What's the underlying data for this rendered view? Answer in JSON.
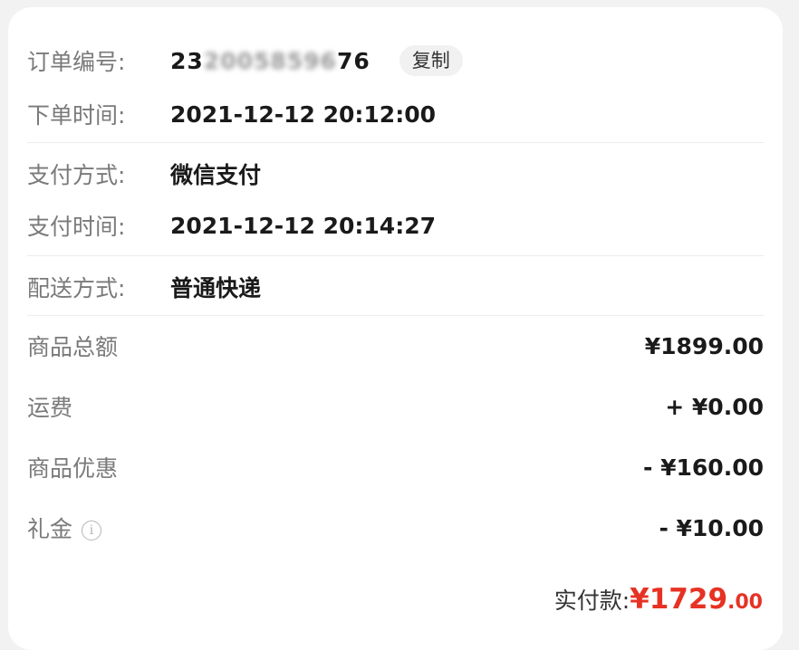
{
  "order": {
    "order_no_label": "订单编号:",
    "order_no_visible_prefix": "23",
    "order_no_hidden": "20058596",
    "order_no_visible_suffix": "76",
    "copy_label": "复制",
    "order_time_label": "下单时间:",
    "order_time": "2021-12-12 20:12:00"
  },
  "payment": {
    "method_label": "支付方式:",
    "method": "微信支付",
    "time_label": "支付时间:",
    "time": "2021-12-12 20:14:27"
  },
  "delivery": {
    "method_label": "配送方式:",
    "method": "普通快递"
  },
  "amounts": {
    "subtotal_label": "商品总额",
    "subtotal": "¥1899.00",
    "shipping_label": "运费",
    "shipping": "+ ¥0.00",
    "discount_label": "商品优惠",
    "discount": "- ¥160.00",
    "gift_label": "礼金",
    "gift_info_icon": "info-icon",
    "gift": "- ¥10.00"
  },
  "total": {
    "label": "实付款:",
    "currency": "¥",
    "integer": "1729",
    "decimal": ".00",
    "color": "#e63224"
  }
}
